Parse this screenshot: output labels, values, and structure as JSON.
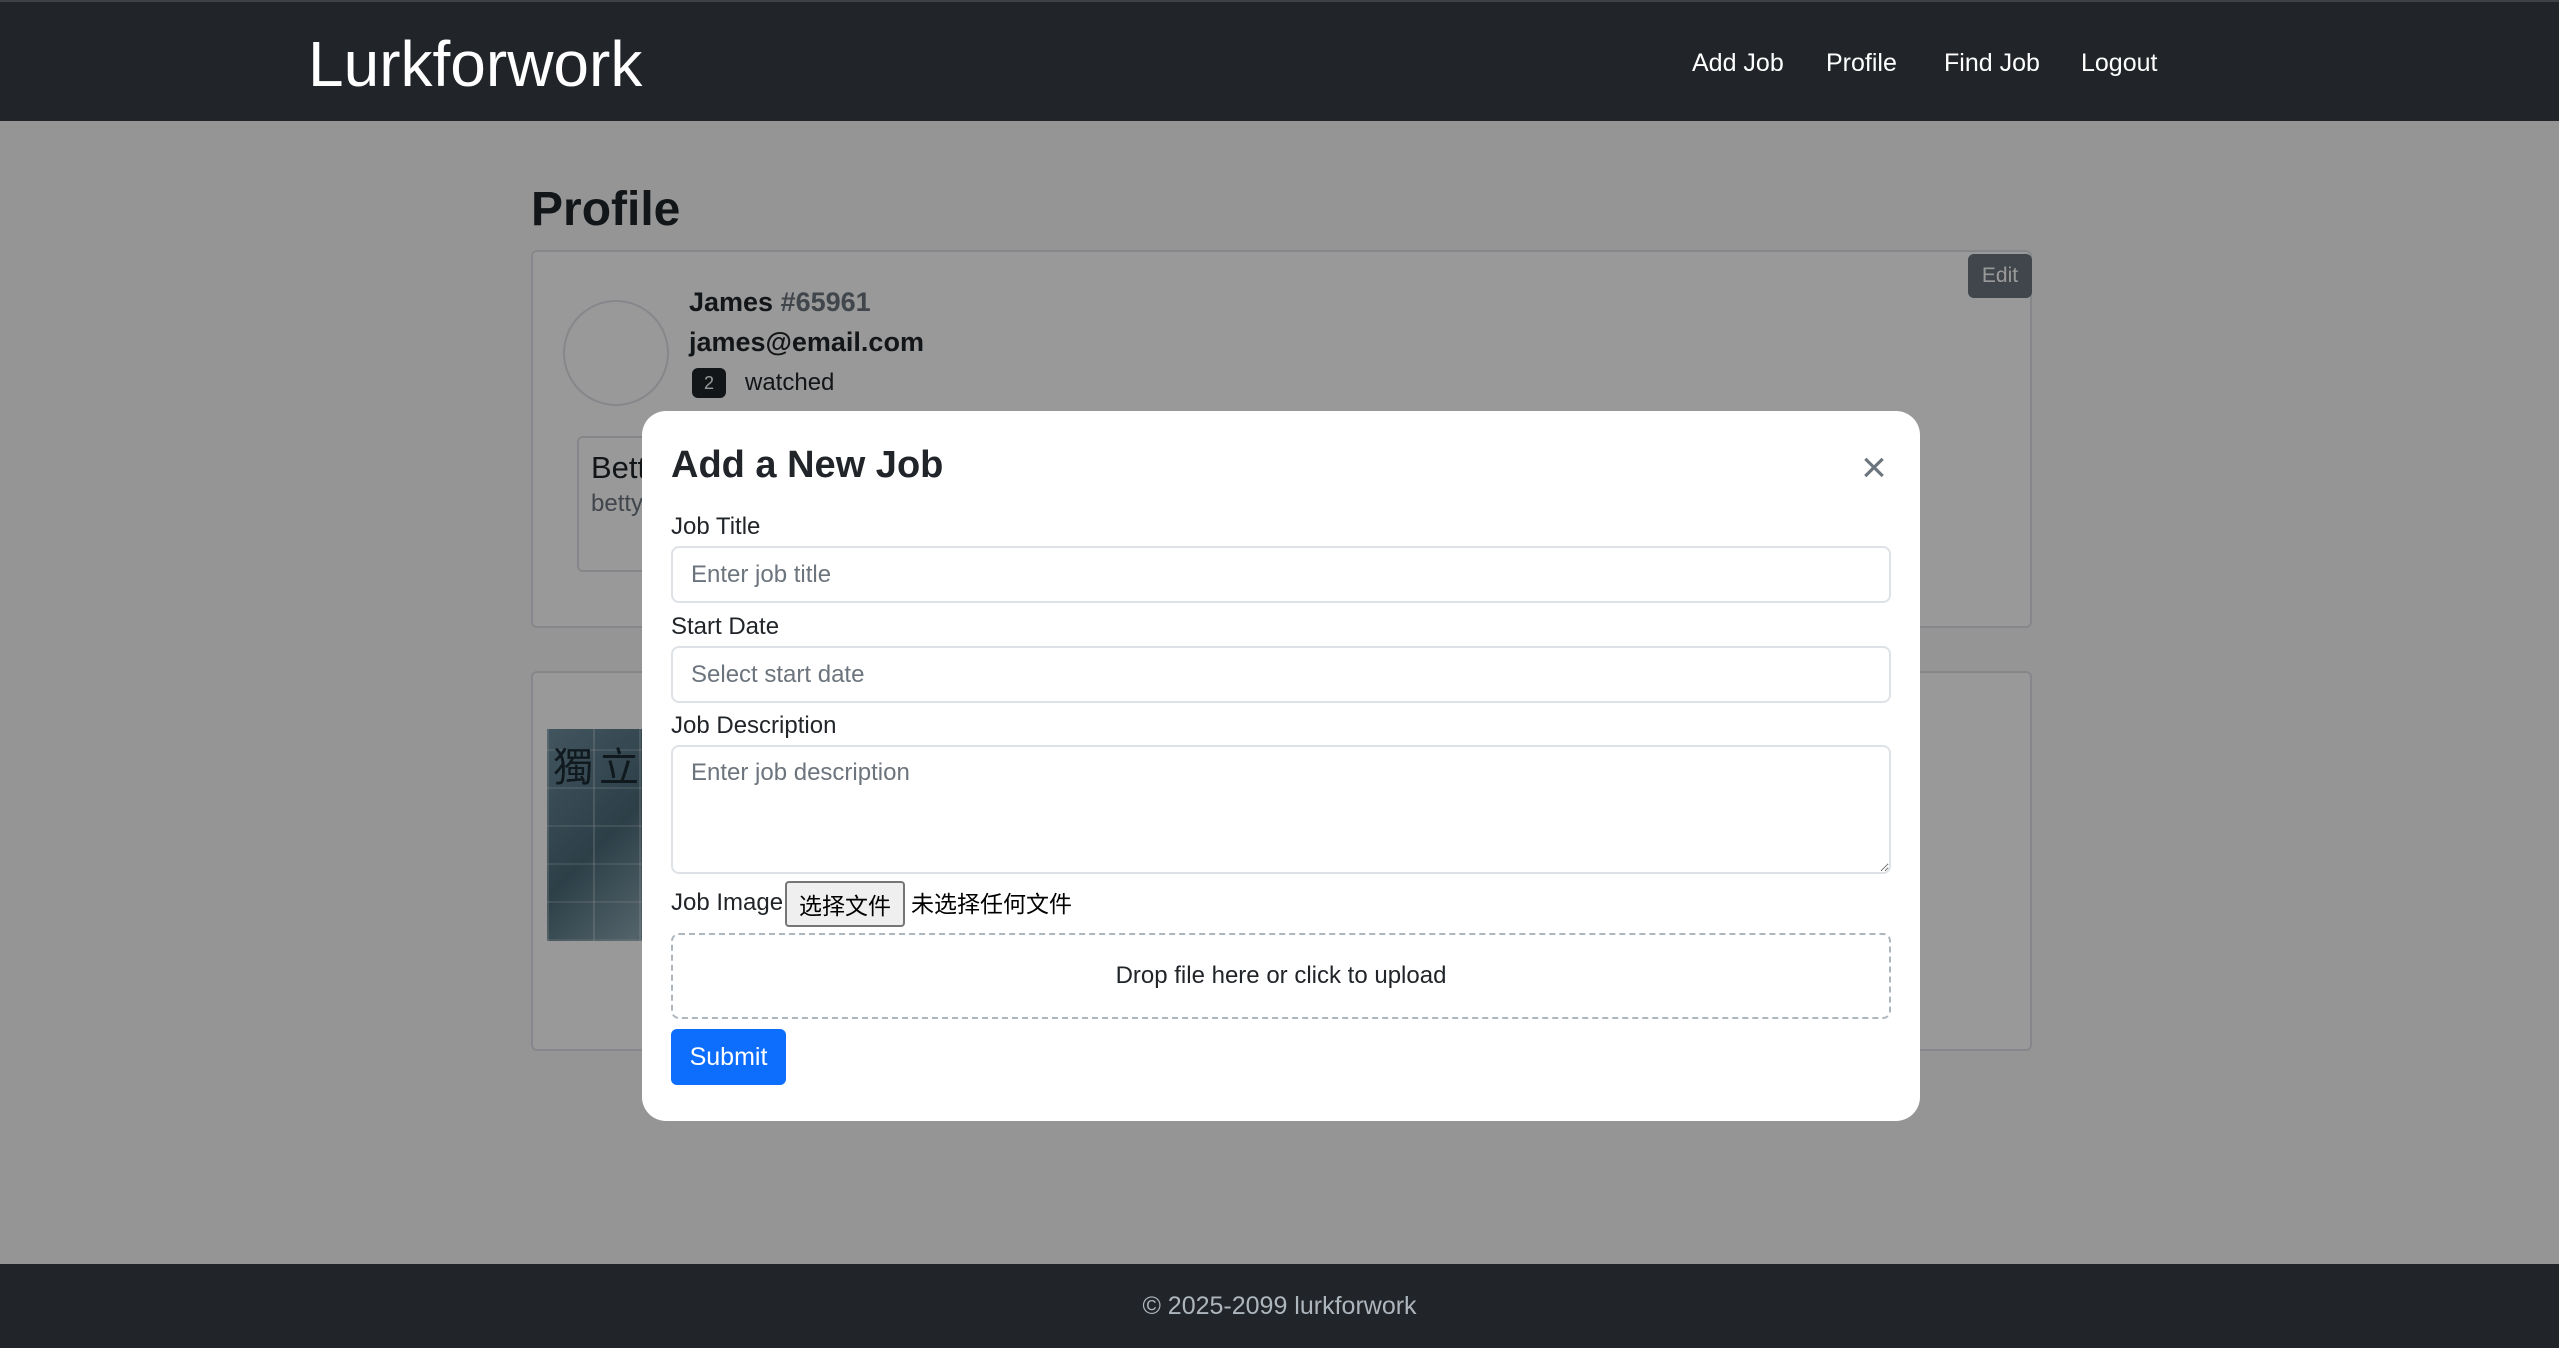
{
  "navbar": {
    "brand": "Lurkforwork",
    "links": [
      "Add Job",
      "Profile",
      "Find Job",
      "Logout"
    ]
  },
  "profile": {
    "page_title": "Profile",
    "edit_label": "Edit",
    "user_name": "James",
    "user_id": "#65961",
    "email": "james@email.com",
    "watch_count": "2",
    "watch_label": "watched",
    "watched_user": {
      "name": "Betty",
      "email": "betty@email.com"
    }
  },
  "job_thumbnail_glyphs": "獨立",
  "modal": {
    "title": "Add a New Job",
    "close_symbol": "×",
    "job_title_label": "Job Title",
    "job_title_placeholder": "Enter job title",
    "start_date_label": "Start Date",
    "start_date_placeholder": "Select start date",
    "description_label": "Job Description",
    "description_placeholder": "Enter job description",
    "image_label": "Job Image",
    "file_button": "选择文件",
    "file_status": "未选择任何文件",
    "dropzone_text": "Drop file here or click to upload",
    "submit_label": "Submit"
  },
  "footer": {
    "text": "© 2025-2099 lurkforwork"
  },
  "colors": {
    "navbar_bg": "#212529",
    "primary": "#0d6efd",
    "secondary": "#6c757d",
    "backdrop": "rgba(0,0,0,0.4)"
  }
}
